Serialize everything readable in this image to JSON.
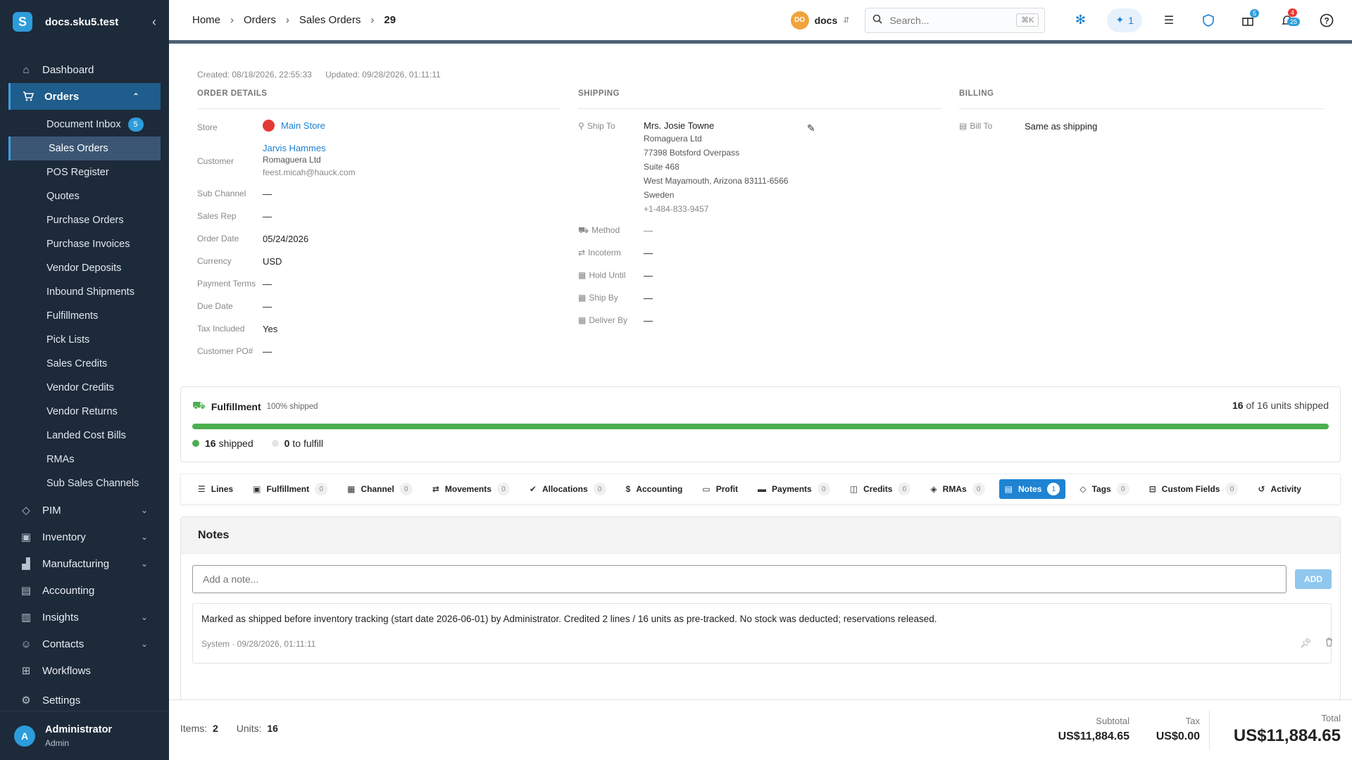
{
  "app": {
    "title": "docs.sku5.test",
    "logo_letter": "S",
    "collapse_icon": "chevron-left-icon"
  },
  "sidebar": {
    "dashboard": "Dashboard",
    "orders": "Orders",
    "sub": {
      "document_inbox": "Document Inbox",
      "document_inbox_badge": "5",
      "sales_orders": "Sales Orders",
      "pos_register": "POS Register",
      "quotes": "Quotes",
      "purchase_orders": "Purchase Orders",
      "purchase_invoices": "Purchase Invoices",
      "vendor_deposits": "Vendor Deposits",
      "inbound_shipments": "Inbound Shipments",
      "fulfillments": "Fulfillments",
      "pick_lists": "Pick Lists",
      "sales_credits": "Sales Credits",
      "vendor_credits": "Vendor Credits",
      "vendor_returns": "Vendor Returns",
      "landed_cost_bills": "Landed Cost Bills",
      "rmas": "RMAs",
      "sub_sales_channels": "Sub Sales Channels"
    },
    "pim": "PIM",
    "inventory": "Inventory",
    "manufacturing": "Manufacturing",
    "accounting": "Accounting",
    "insights": "Insights",
    "contacts": "Contacts",
    "workflows": "Workflows",
    "settings": "Settings",
    "user": {
      "initial": "A",
      "name": "Administrator",
      "role": "Admin"
    }
  },
  "topbar": {
    "breadcrumb": [
      "Home",
      "Orders",
      "Sales Orders",
      "29"
    ],
    "org_initials": "DO",
    "org_name": "docs",
    "search_placeholder": "Search...",
    "search_shortcut": "⌘K",
    "ai_count": "1",
    "gift_badge": "5",
    "notif_badge_red": "4",
    "notif_badge_blue": "25"
  },
  "order": {
    "created": "Created: 08/18/2026, 22:55:33",
    "updated": "Updated: 09/28/2026, 01:11:11",
    "details_title": "ORDER DETAILS",
    "shipping_title": "SHIPPING",
    "billing_title": "BILLING",
    "labels": {
      "store": "Store",
      "customer": "Customer",
      "sub_channel": "Sub Channel",
      "sales_rep": "Sales Rep",
      "order_date": "Order Date",
      "currency": "Currency",
      "payment_terms": "Payment Terms",
      "due_date": "Due Date",
      "tax_included": "Tax Included",
      "customer_po": "Customer PO#"
    },
    "store": "Main Store",
    "customer_name": "Jarvis Hammes",
    "customer_company": "Romaguera Ltd",
    "customer_email": "feest.micah@hauck.com",
    "sub_channel": "—",
    "sales_rep": "—",
    "order_date": "05/24/2026",
    "currency": "USD",
    "payment_terms": "—",
    "due_date": "—",
    "tax_included": "Yes",
    "customer_po": "—"
  },
  "shipping": {
    "labels": {
      "ship_to": "Ship To",
      "method": "Method",
      "incoterm": "Incoterm",
      "hold_until": "Hold Until",
      "ship_by": "Ship By",
      "deliver_by": "Deliver By"
    },
    "name": "Mrs. Josie Towne",
    "company": "Romaguera Ltd",
    "line1": "77398 Botsford Overpass",
    "line2": "Suite 468",
    "city": "West Mayamouth, Arizona 83111-6566",
    "country": "Sweden",
    "phone": "+1-484-833-9457",
    "method": "—",
    "incoterm": "—",
    "hold_until": "—",
    "ship_by": "—",
    "deliver_by": "—"
  },
  "billing": {
    "label": "Bill To",
    "value": "Same as shipping"
  },
  "fulfillment": {
    "title": "Fulfillment",
    "percent_label": "100% shipped",
    "progress": 1.0,
    "units_shipped": "16",
    "units_total_text": "of 16 units shipped",
    "shipped_count": "16",
    "shipped_label": "shipped",
    "to_fulfill_count": "0",
    "to_fulfill_label": "to fulfill",
    "bar_color": "#4caf50"
  },
  "tabs": [
    {
      "label": "Lines",
      "icon": "list-icon",
      "count": ""
    },
    {
      "label": "Fulfillment",
      "icon": "clipboard-icon",
      "count": "0"
    },
    {
      "label": "Channel",
      "icon": "store-icon",
      "count": "0"
    },
    {
      "label": "Movements",
      "icon": "arrows-icon",
      "count": "0"
    },
    {
      "label": "Allocations",
      "icon": "check-badge-icon",
      "count": "0"
    },
    {
      "label": "Accounting",
      "icon": "dollar-icon",
      "count": ""
    },
    {
      "label": "Profit",
      "icon": "cash-icon",
      "count": ""
    },
    {
      "label": "Payments",
      "icon": "card-icon",
      "count": "0"
    },
    {
      "label": "Credits",
      "icon": "bag-icon",
      "count": "0"
    },
    {
      "label": "RMAs",
      "icon": "box-icon",
      "count": "0"
    },
    {
      "label": "Notes",
      "icon": "note-icon",
      "count": "1"
    },
    {
      "label": "Tags",
      "icon": "tag-icon",
      "count": "0"
    },
    {
      "label": "Custom Fields",
      "icon": "fields-icon",
      "count": "0"
    },
    {
      "label": "Activity",
      "icon": "history-icon",
      "count": ""
    }
  ],
  "notes": {
    "title": "Notes",
    "placeholder": "Add a note...",
    "add_label": "ADD",
    "item_text": "Marked as shipped before inventory tracking (start date 2026-06-01) by Administrator. Credited 2 lines / 16 units as pre-tracked. No stock was deducted; reservations released.",
    "item_meta": "System · 09/28/2026, 01:11:11"
  },
  "footer": {
    "items_label": "Items:",
    "items_value": "2",
    "units_label": "Units:",
    "units_value": "16",
    "subtotal_label": "Subtotal",
    "subtotal_value": "US$11,884.65",
    "tax_label": "Tax",
    "tax_value": "US$0.00",
    "total_label": "Total",
    "total_value": "US$11,884.65"
  },
  "colors": {
    "sidebar_bg": "#1d2a3a",
    "accent": "#1f83d2",
    "success": "#4caf50"
  }
}
